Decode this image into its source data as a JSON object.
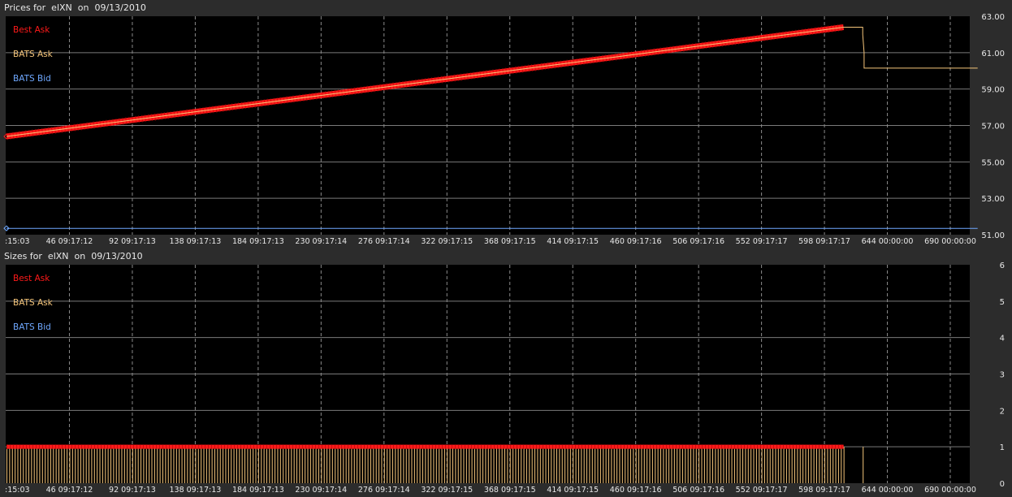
{
  "colors": {
    "background": "#000000",
    "frame": "#2c2c2c",
    "grid": "#8a8a8a",
    "text": "#e8e8e8",
    "best_ask": "#ff1a1a",
    "bats_ask": "#f5c57a",
    "bats_bid": "#6fa8ff"
  },
  "x_tick_labels": [
    ":15:03",
    "46 09:17:12",
    "92 09:17:13",
    "138 09:17:13",
    "184 09:17:13",
    "230 09:17:14",
    "276 09:17:14",
    "322 09:17:15",
    "368 09:17:15",
    "414 09:17:15",
    "460 09:17:16",
    "506 09:17:16",
    "552 09:17:17",
    "598 09:17:17",
    "644 00:00:00",
    "690 00:00:00"
  ],
  "chart_data": [
    {
      "type": "line",
      "title": "Prices for  elXN  on  09/13/2010",
      "x_index_range": [
        0,
        710
      ],
      "x_ticks": [
        0,
        46,
        92,
        138,
        184,
        230,
        276,
        322,
        368,
        414,
        460,
        506,
        552,
        598,
        644,
        690
      ],
      "ylim": [
        51,
        63
      ],
      "y_ticks": [
        51.0,
        53.0,
        55.0,
        57.0,
        59.0,
        61.0,
        63.0
      ],
      "y_tick_labels": [
        "51.00",
        "53.00",
        "55.00",
        "57.00",
        "59.00",
        "61.00",
        "63.00"
      ],
      "grid": true,
      "legend": "top-left",
      "series": [
        {
          "name": "Best Ask",
          "color": "#ff1a1a",
          "points": [
            [
              0,
              56.4
            ],
            [
              612,
              62.4
            ]
          ]
        },
        {
          "name": "BATS Ask",
          "color": "#f5c57a",
          "points": [
            [
              0,
              56.4
            ],
            [
              612,
              62.4
            ],
            [
              626,
              62.4
            ],
            [
              626,
              62.0
            ],
            [
              627,
              61.0
            ],
            [
              627,
              60.15
            ],
            [
              710,
              60.15
            ]
          ]
        },
        {
          "name": "BATS Bid",
          "color": "#6fa8ff",
          "points": [
            [
              0,
              51.35
            ],
            [
              710,
              51.35
            ]
          ]
        }
      ]
    },
    {
      "type": "bar",
      "title": "Sizes for  elXN  on  09/13/2010",
      "x_index_range": [
        0,
        710
      ],
      "x_ticks": [
        0,
        46,
        92,
        138,
        184,
        230,
        276,
        322,
        368,
        414,
        460,
        506,
        552,
        598,
        644,
        690
      ],
      "ylim": [
        0,
        6
      ],
      "y_ticks": [
        0,
        1,
        2,
        3,
        4,
        5,
        6
      ],
      "y_tick_labels": [
        "0",
        "1",
        "2",
        "3",
        "4",
        "5",
        "6"
      ],
      "grid": true,
      "legend": "top-left",
      "series": [
        {
          "name": "Best Ask",
          "color": "#ff1a1a",
          "x_range": [
            0,
            612
          ],
          "value": 1
        },
        {
          "name": "BATS Ask",
          "color": "#f5c57a",
          "x_range": [
            0,
            612
          ],
          "value": 1,
          "extra_x": [
            626
          ]
        },
        {
          "name": "BATS Bid",
          "color": "#6fa8ff",
          "x_range": [
            0,
            0
          ],
          "value": 0
        }
      ]
    }
  ]
}
